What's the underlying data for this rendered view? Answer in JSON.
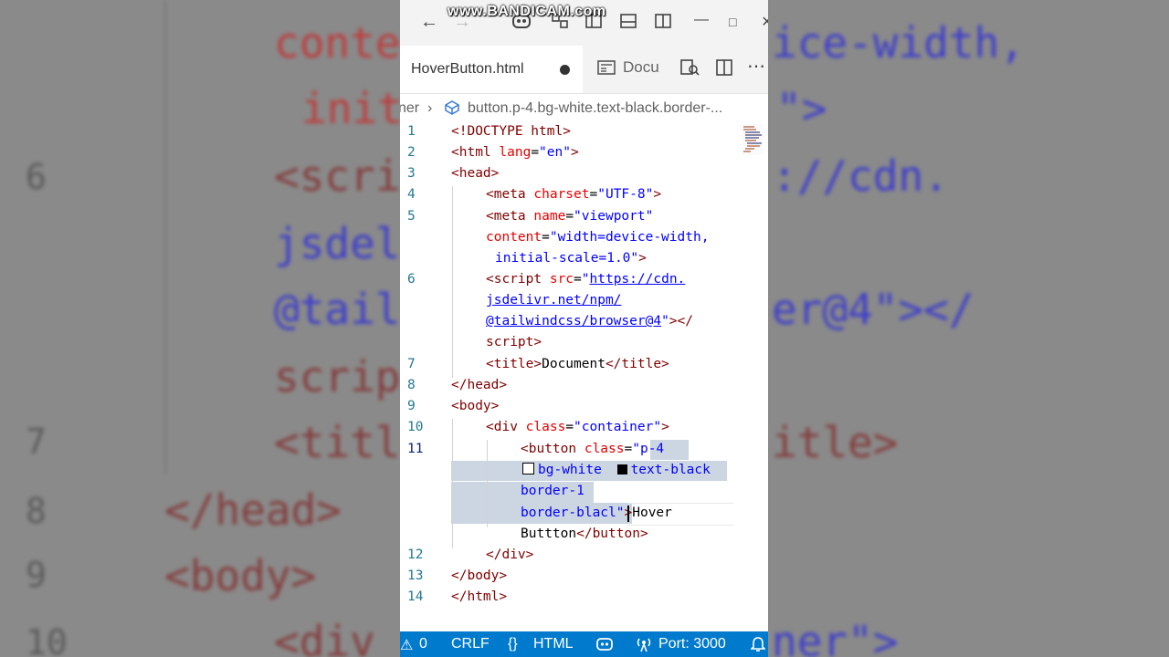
{
  "watermark": "www.BANDICAM.com",
  "window": {
    "title_icons": [
      "back-icon",
      "forward-icon",
      "copilot-icon",
      "layout-icon",
      "sidebar-icon",
      "panel-icon",
      "split-icon",
      "minimize-icon",
      "maximize-icon",
      "close-icon"
    ]
  },
  "tabs": {
    "active_label": "HoverButton.html",
    "second_label": "Docu"
  },
  "breadcrumb": {
    "parent": "ner",
    "current": "button.p-4.bg-white.text-black.border-..."
  },
  "editor": {
    "line_numbers": {
      "l1": "1",
      "l2": "2",
      "l3": "3",
      "l4": "4",
      "l5": "5",
      "l6": "6",
      "l7": "7",
      "l8": "8",
      "l9": "9",
      "l10": "10",
      "l11": "11",
      "l12": "12",
      "l13": "13",
      "l14": "14"
    },
    "active_line": "11"
  },
  "background_text": {
    "b1": "conte",
    "b1b": "ice-width,",
    "b2": "init",
    "b2b": "\">",
    "b3": "<scri",
    "b3b": "://cdn.",
    "b4": "jsdel",
    "b5": "@tail",
    "b5b": "er@4\"></",
    "b6": "scrip",
    "b7": "<titl",
    "b7b": "itle>",
    "b8": "</head>",
    "b9": "<body>",
    "b10": "<div",
    "b10b": "ner\">",
    "n6": "6",
    "n7": "7",
    "n8": "8",
    "n9": "9",
    "n10": "10"
  },
  "colors": {
    "status_bar": "#007acc",
    "tag": "#800000",
    "attribute": "#e50000",
    "string": "#0000ff",
    "selection": "#cbd6e2"
  },
  "status": {
    "errors": "0",
    "line_ending": "CRLF",
    "language": "HTML",
    "port": "Port: 3000"
  }
}
